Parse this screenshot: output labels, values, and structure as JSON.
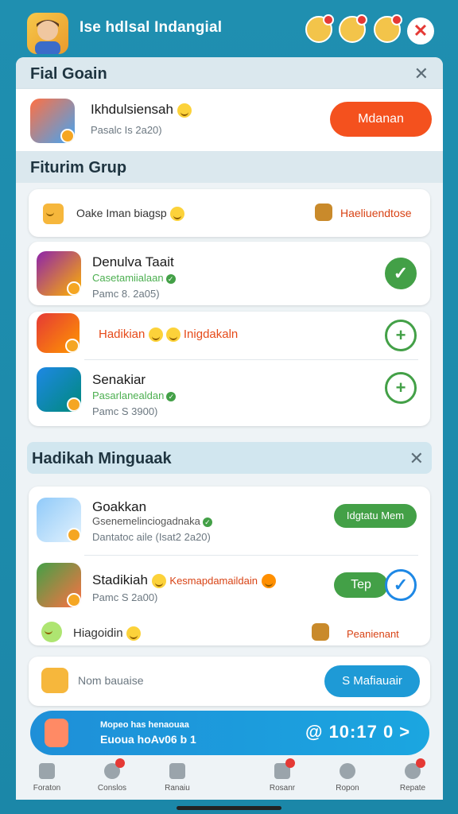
{
  "app": {
    "title": "Ise hdlsal Indangial",
    "close_glyph": "✕"
  },
  "top_icons": [
    {
      "name": "friend-1"
    },
    {
      "name": "friend-2"
    },
    {
      "name": "friend-3"
    }
  ],
  "section1": {
    "title": "Fial Goain",
    "user": {
      "name": "Ikhdulsiensah",
      "meta": "Pasalc Is 2a20)"
    },
    "action": "Mdanan"
  },
  "section2": {
    "title": "Fiturim Grup",
    "banner": {
      "left": "Oake Iman biagsp",
      "right": "Haeliuendtose"
    },
    "items": [
      {
        "name": "Denulva Taait",
        "sub": "Casetamiialaan",
        "meta": "Pamc 8. 2a05)",
        "action": "check"
      },
      {
        "name": "Hadikian",
        "tag": "Inigdakaln",
        "action": "add"
      },
      {
        "name": "Senakiar",
        "sub": "Pasarlanealdan",
        "meta": "Pamc S 3900)",
        "action": "add"
      }
    ]
  },
  "section3": {
    "title": "Hadikah Minguaak",
    "items": [
      {
        "name": "Goakkan",
        "sub": "Gsenemelinciogadnaka",
        "meta": "Dantatoc aile (Isat2 2a20)",
        "action": "Idgtatu Mem"
      },
      {
        "name": "Stadikiah",
        "tag": "Kesmapdamaildain",
        "meta": "Pamc S 2a00)",
        "action": "Tep"
      }
    ],
    "banner": {
      "left": "Hiagoidin",
      "right": "Peanienant"
    },
    "input": {
      "placeholder": "Nom bauaise",
      "button": "S Mafiauair"
    }
  },
  "promo": {
    "line1": "Mopeo has henaouaa",
    "line2": "Euoua hoAv06 b 1",
    "timer": "@ 10:17 0 >"
  },
  "nav": [
    {
      "label": "Foraton",
      "badge": false
    },
    {
      "label": "Conslos",
      "badge": true
    },
    {
      "label": "Ranaiu",
      "badge": false
    },
    {
      "label": "Rosanr",
      "badge": true
    },
    {
      "label": "Ropon",
      "badge": false
    },
    {
      "label": "Repate",
      "badge": true
    }
  ]
}
